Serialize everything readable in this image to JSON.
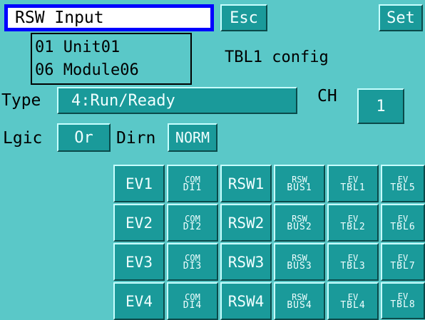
{
  "header": {
    "title": "RSW Input",
    "esc_label": "Esc",
    "set_label": "Set"
  },
  "unit": {
    "line1": "01 Unit01",
    "line2": "06 Module06"
  },
  "config_title": "TBL1 config",
  "type": {
    "label": "Type",
    "value": "4:Run/Ready"
  },
  "ch": {
    "label": "CH",
    "value": "1"
  },
  "logic": {
    "label": "Lgic",
    "value": "Or"
  },
  "dirn": {
    "label": "Dirn",
    "value": "NORM"
  },
  "grid": {
    "r1": {
      "ev": "EV1",
      "com_top": "COM",
      "com_bot": "DI1",
      "rsw": "RSW1",
      "rbus_top": "RSW",
      "rbus_bot": "BUS1",
      "tbl_a_top": "EV",
      "tbl_a_bot": "TBL1",
      "tbl_b_top": "EV",
      "tbl_b_bot": "TBL5"
    },
    "r2": {
      "ev": "EV2",
      "com_top": "COM",
      "com_bot": "DI2",
      "rsw": "RSW2",
      "rbus_top": "RSW",
      "rbus_bot": "BUS2",
      "tbl_a_top": "EV",
      "tbl_a_bot": "TBL2",
      "tbl_b_top": "EV",
      "tbl_b_bot": "TBL6"
    },
    "r3": {
      "ev": "EV3",
      "com_top": "COM",
      "com_bot": "DI3",
      "rsw": "RSW3",
      "rbus_top": "RSW",
      "rbus_bot": "BUS3",
      "tbl_a_top": "EV",
      "tbl_a_bot": "TBL3",
      "tbl_b_top": "EV",
      "tbl_b_bot": "TBL7"
    },
    "r4": {
      "ev": "EV4",
      "com_top": "COM",
      "com_bot": "DI4",
      "rsw": "RSW4",
      "rbus_top": "RSW",
      "rbus_bot": "BUS4",
      "tbl_a_top": "EV",
      "tbl_a_bot": "TBL4",
      "tbl_b_top": "EV",
      "tbl_b_bot": "TBL8"
    }
  }
}
